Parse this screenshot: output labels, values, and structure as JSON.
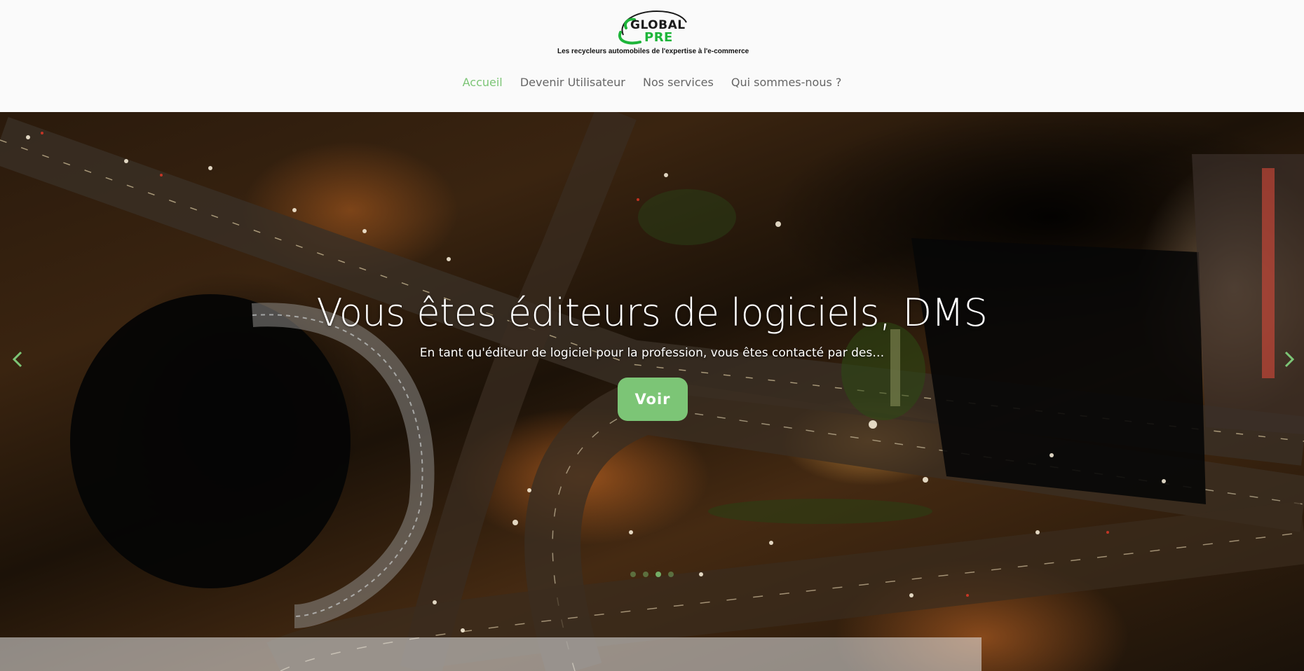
{
  "brand": {
    "word1": "GLOBAL",
    "word2": "PRE",
    "tagline": "Les recycleurs automobiles de l'expertise à l'e-commerce",
    "accent_color": "#7cc576",
    "logo_green": "#1eb53a"
  },
  "nav": {
    "items": [
      {
        "label": "Accueil",
        "active": true
      },
      {
        "label": "Devenir Utilisateur",
        "active": false
      },
      {
        "label": "Nos services",
        "active": false
      },
      {
        "label": "Qui sommes-nous ?",
        "active": false
      }
    ]
  },
  "hero": {
    "title": "Vous êtes éditeurs de logiciels, DMS",
    "subtitle": "En tant qu'éditeur de logiciel pour la profession, vous êtes contacté par des…",
    "cta_label": "Voir",
    "prev_icon": "chevron-left-icon",
    "next_icon": "chevron-right-icon",
    "slide_count": 4,
    "active_slide": 3
  }
}
